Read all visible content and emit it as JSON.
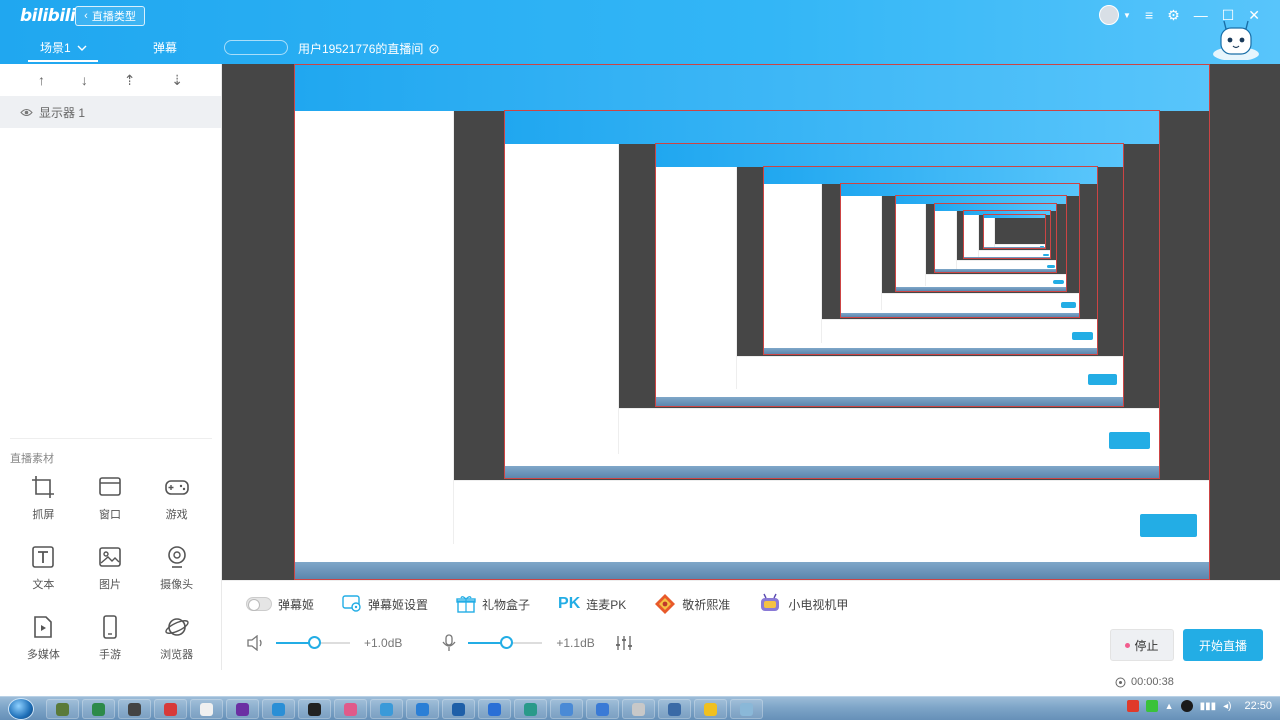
{
  "header": {
    "logo": "bilibili",
    "back_label": "直播类型",
    "scene_tab": "场景1",
    "danmu_tab": "弹幕",
    "room_title": "用户19521776的直播间"
  },
  "sources": {
    "items": [
      {
        "label": "显示器 1"
      }
    ]
  },
  "materials": {
    "title": "直播素材",
    "items": [
      {
        "label": "抓屏",
        "icon": "crop-icon"
      },
      {
        "label": "窗口",
        "icon": "window-icon"
      },
      {
        "label": "游戏",
        "icon": "gamepad-icon"
      },
      {
        "label": "文本",
        "icon": "text-icon"
      },
      {
        "label": "图片",
        "icon": "image-icon"
      },
      {
        "label": "摄像头",
        "icon": "camera-icon"
      },
      {
        "label": "多媒体",
        "icon": "media-icon"
      },
      {
        "label": "手游",
        "icon": "phone-icon"
      },
      {
        "label": "浏览器",
        "icon": "browser-icon"
      }
    ]
  },
  "tools": {
    "danmu_ji": "弹幕姬",
    "danmu_ji_settings": "弹幕姬设置",
    "gift_box": "礼物盒子",
    "pk_label": "连麦PK",
    "pray": "敬祈熙准",
    "tv": "小电视机甲"
  },
  "audio": {
    "speaker_db": "+1.0dB",
    "speaker_level": 0.52,
    "mic_db": "+1.1dB",
    "mic_level": 0.52
  },
  "controls": {
    "stop": "停止",
    "start": "开始直播",
    "timer": "00:00:38"
  },
  "taskbar": {
    "clock": "22:50",
    "app_colors": [
      "#5a7a3a",
      "#2d8a4a",
      "#444444",
      "#d73a3a",
      "#f0f0f0",
      "#6b2fa3",
      "#2a8fd6",
      "#222222",
      "#e05a8a",
      "#3a9ad9",
      "#2a7fd6",
      "#1e5fa8",
      "#2a6fd6",
      "#2a9a8a",
      "#4a8ad6",
      "#3a7ad6",
      "#c8c8c8",
      "#3a6aa6",
      "#f0c020",
      "#8ab8d8"
    ]
  },
  "colors": {
    "brand": "#23ade5",
    "header_start": "#20a7f0",
    "pink": "#f25d8e"
  }
}
